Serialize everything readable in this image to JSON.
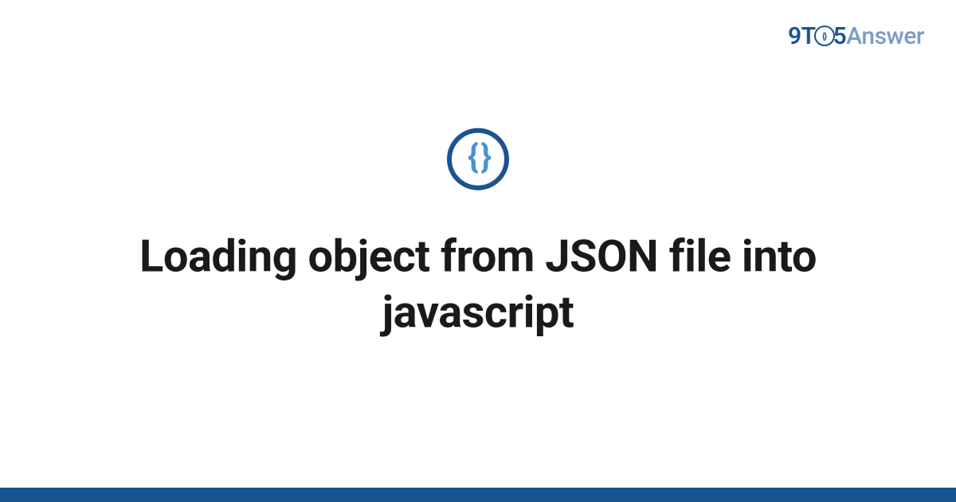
{
  "header": {
    "logo_9t": "9T",
    "logo_circle_inner": "{}",
    "logo_5": "5",
    "logo_answer": "Answer"
  },
  "main": {
    "icon_braces": "{ }",
    "title": "Loading object from JSON file into javascript"
  },
  "colors": {
    "primary": "#1a5490",
    "secondary": "#7a9cc6",
    "icon_fill": "#4a90d9"
  }
}
